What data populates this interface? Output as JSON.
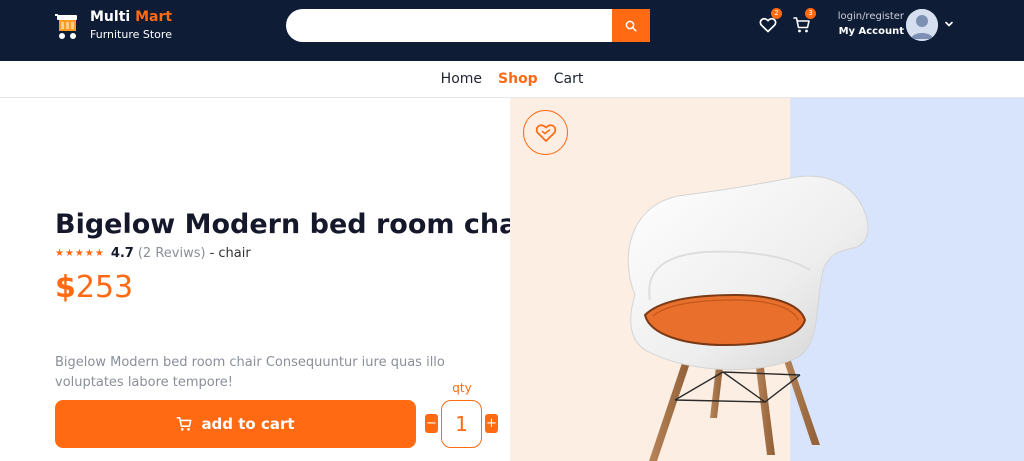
{
  "header": {
    "logo_word1": "Multi",
    "logo_word2": "Mart",
    "logo_sub": "Furniture Store",
    "search_placeholder": "",
    "wishlist_count": "2",
    "cart_count": "3",
    "account_small": "login/register",
    "account_big": "My Account"
  },
  "nav": {
    "items": [
      {
        "label": "Home",
        "active": false
      },
      {
        "label": "Shop",
        "active": true
      },
      {
        "label": "Cart",
        "active": false
      }
    ]
  },
  "product": {
    "title": "Bigelow Modern bed room chair",
    "stars": "★★★★★",
    "rating": "4.7",
    "reviews": "(2 Reviws)",
    "category": "- chair",
    "currency": "$",
    "price": "253",
    "description": "Bigelow Modern bed room chair Consequuntur iure quas illo voluptates labore tempore!",
    "add_to_cart": "add to cart",
    "qty_label": "qty",
    "qty_value": "1",
    "qty_minus": "−",
    "qty_plus": "+"
  },
  "icons": {
    "logo": "cart-logo-icon",
    "search": "search-icon",
    "wishlist": "heart-icon",
    "cart": "cart-icon",
    "avatar": "user-avatar",
    "caret": "chevron-down-icon",
    "add_to_cart": "cart-icon",
    "wish_button": "heart-icon"
  },
  "colors": {
    "header_bg": "#0e1c35",
    "accent": "#ff6a13",
    "hero_left_bg": "#fdeee3",
    "hero_right_bg": "#d8e4fb",
    "text_dark": "#15182a",
    "text_muted": "#8a8f99"
  }
}
